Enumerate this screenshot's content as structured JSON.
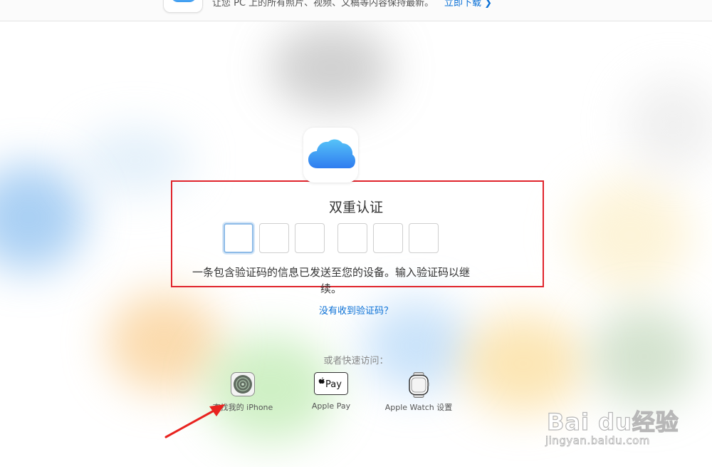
{
  "banner": {
    "text": "让您 PC 上的所有照片、视频、文稿等内容保持最新。",
    "link_label": "立即下载 ❯"
  },
  "twofa": {
    "title": "双重认证",
    "message": "一条包含验证码的信息已发送至您的设备。输入验证码以继续。",
    "code_digits": [
      "",
      "",
      "",
      "",
      "",
      ""
    ],
    "no_code_link": "没有收到验证码？"
  },
  "quick_access": {
    "label": "或者快速访问：",
    "items": [
      {
        "label": "查找我的 iPhone",
        "icon": "find-my-iphone-icon"
      },
      {
        "label": "Apple Pay",
        "icon": "apple-pay-icon"
      },
      {
        "label": "Apple Watch 设置",
        "icon": "apple-watch-icon"
      }
    ],
    "applepay_icon_text": "Pay"
  },
  "watermark": {
    "brand": "Bai du经验",
    "url": "jingyan.baidu.com"
  },
  "colors": {
    "highlight_box": "#e0242c",
    "link": "#0a70d6",
    "active_input": "#8dbbe8"
  }
}
